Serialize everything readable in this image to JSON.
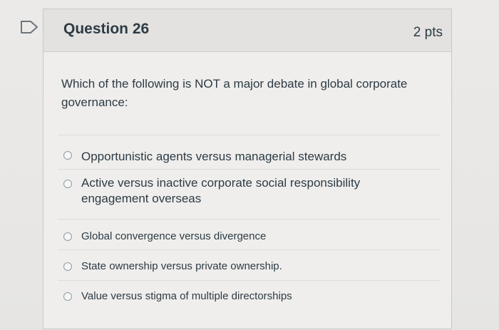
{
  "question": {
    "title": "Question 26",
    "points": "2 pts",
    "text": "Which of the following is NOT a major debate in global corporate governance:",
    "answers": [
      {
        "label": "Opportunistic agents versus managerial stewards",
        "selected": false
      },
      {
        "label": "Active versus inactive corporate social responsibility engagement overseas",
        "selected": false
      },
      {
        "label": "Global convergence versus divergence",
        "selected": false
      },
      {
        "label": "State ownership versus private ownership.",
        "selected": false
      },
      {
        "label": "Value versus stigma of multiple directorships",
        "selected": false
      }
    ]
  },
  "icons": {
    "flag": "flag-icon"
  },
  "colors": {
    "text": "#2d3b45",
    "header_background": "#e3e2e0",
    "radio_border": "#8f9aa3"
  }
}
